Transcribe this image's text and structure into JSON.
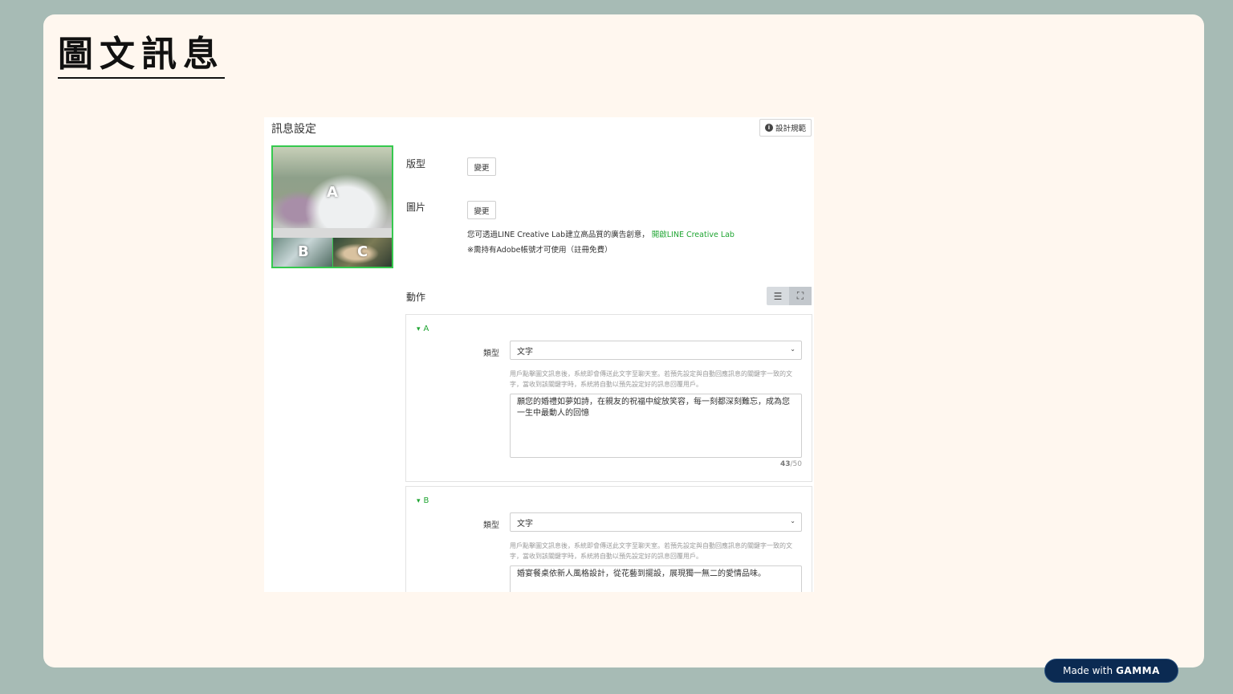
{
  "slide": {
    "title": "圖文訊息"
  },
  "panel": {
    "title": "訊息設定",
    "design_guide_icon": "info-circle-icon",
    "design_guide_label": "設計規範"
  },
  "preview": {
    "cell_labels": [
      "A",
      "B",
      "C"
    ]
  },
  "layout_field": {
    "label": "版型",
    "button": "變更"
  },
  "image_field": {
    "label": "圖片",
    "button": "變更",
    "note_text": "您可透過LINE Creative Lab建立高品質的廣告創意，",
    "note_link": "開啟LINE Creative Lab",
    "adobe_note": "※需持有Adobe帳號才可使用（註冊免費）"
  },
  "actions": {
    "label": "動作",
    "list_view_icon": "list-icon",
    "fullscreen_icon": "expand-icon",
    "items": [
      {
        "id": "A",
        "type_label": "類型",
        "type_value": "文字",
        "hint": "用戶點擊圖文訊息後，系統即會傳送此文字至聊天室。若預先設定與自動回應訊息的關鍵字一致的文字，當收到該關鍵字時，系統將自動以預先設定好的訊息回覆用戶。",
        "text": "願您的婚禮如夢如詩，在親友的祝福中綻放笑容，每一刻都深刻難忘，成為您一生中最動人的回憶",
        "count": "43",
        "max": "/50"
      },
      {
        "id": "B",
        "type_label": "類型",
        "type_value": "文字",
        "hint": "用戶點擊圖文訊息後，系統即會傳送此文字至聊天室。若預先設定與自動回應訊息的關鍵字一致的文字，當收到該關鍵字時，系統將自動以預先設定好的訊息回覆用戶。",
        "text": "婚宴餐桌依新人風格設計，從花藝到擺設，展現獨一無二的愛情品味。"
      }
    ]
  },
  "badge": {
    "prefix": "Made with",
    "brand": "GAMMA"
  },
  "colors": {
    "accent": "#1fa532",
    "slide_bg": "#fff7ef",
    "page_bg": "#a7bbb5",
    "badge_bg": "#0b2a52"
  }
}
